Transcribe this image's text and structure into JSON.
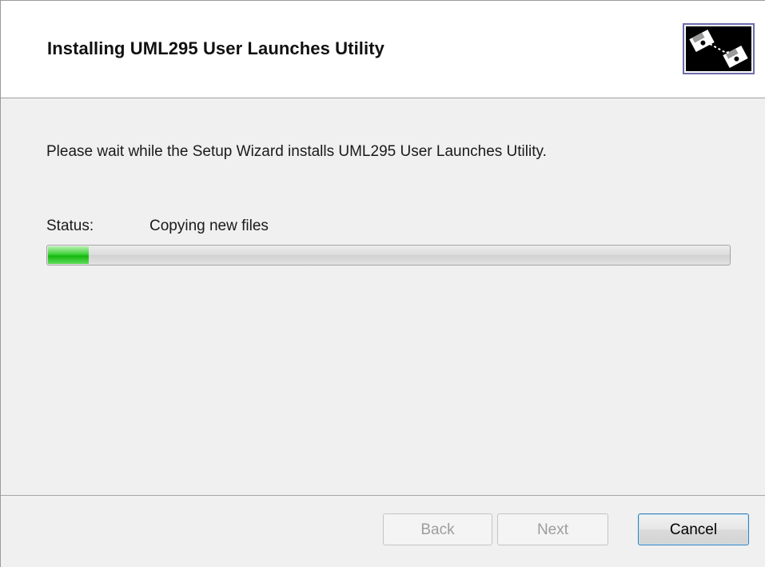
{
  "window": {
    "title": "Installing UML295 User Launches Utility"
  },
  "header": {
    "icon": "installer-disks-icon"
  },
  "body": {
    "message": "Please wait while the Setup Wizard installs UML295 User Launches Utility.",
    "status_label": "Status:",
    "status_value": "Copying new files",
    "progress_fraction": 0.06
  },
  "footer": {
    "back_label": "Back",
    "next_label": "Next",
    "cancel_label": "Cancel"
  },
  "colors": {
    "progress_green": "#16b80f",
    "default_button_border": "#3c7fb1"
  }
}
